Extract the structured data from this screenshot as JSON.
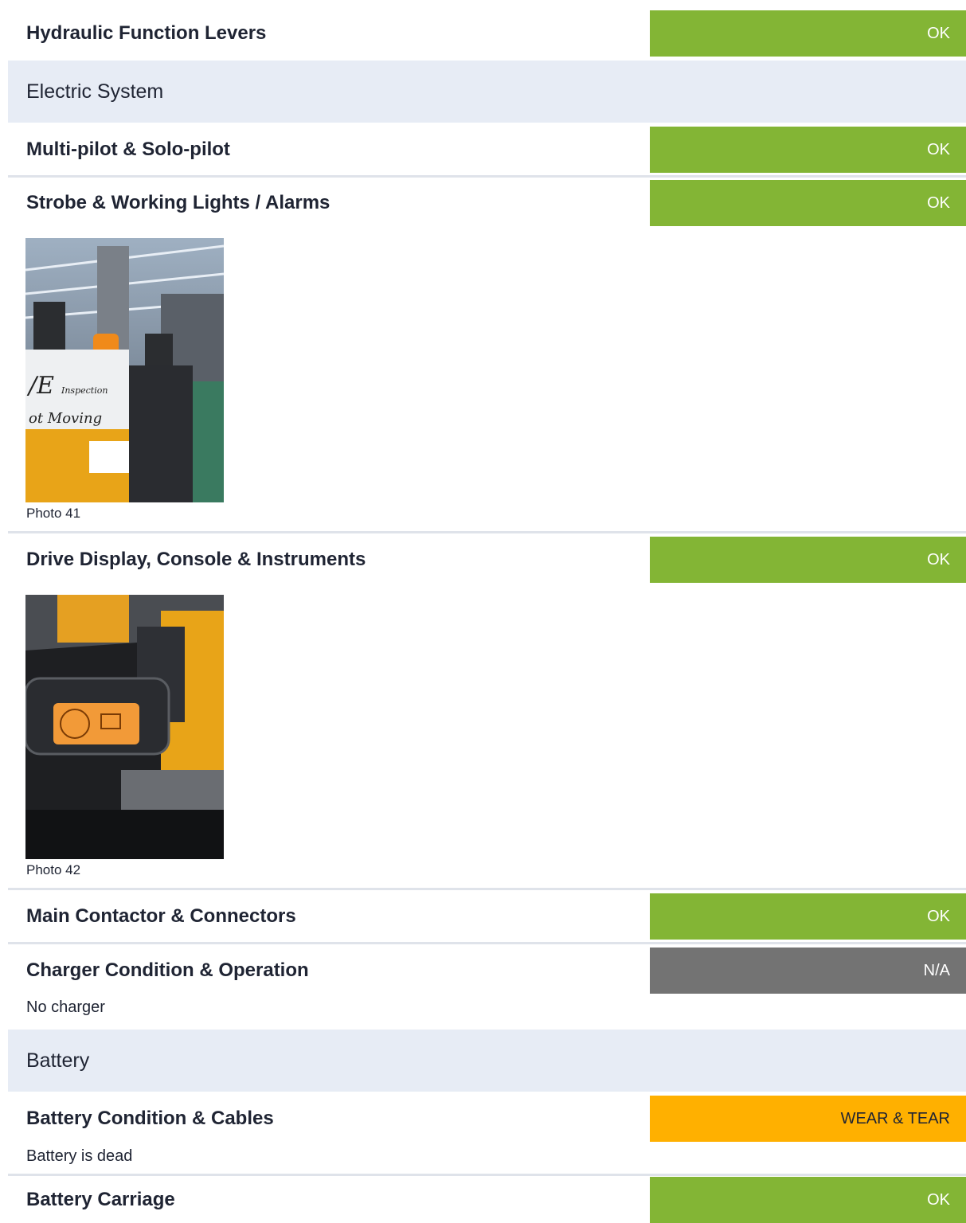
{
  "colors": {
    "ok": "#83b535",
    "na": "#737373",
    "wear": "#ffb000",
    "section_bg": "#e7ecf5"
  },
  "items": [
    {
      "title": "Hydraulic Function Levers",
      "status": "OK"
    },
    {
      "title": "Multi-pilot & Solo-pilot",
      "status": "OK"
    },
    {
      "title": "Strobe & Working Lights / Alarms",
      "status": "OK",
      "photo_caption": "Photo 41"
    },
    {
      "title": "Drive Display, Console & Instruments",
      "status": "OK",
      "photo_caption": "Photo 42"
    },
    {
      "title": "Main Contactor & Connectors",
      "status": "OK"
    },
    {
      "title": "Charger Condition & Operation",
      "status": "N/A",
      "note": "No charger"
    },
    {
      "title": "Battery Condition & Cables",
      "status": "WEAR & TEAR",
      "note": "Battery is dead"
    },
    {
      "title": "Battery Carriage",
      "status": "OK"
    }
  ],
  "sections": [
    {
      "label": "Electric System"
    },
    {
      "label": "Battery"
    }
  ]
}
